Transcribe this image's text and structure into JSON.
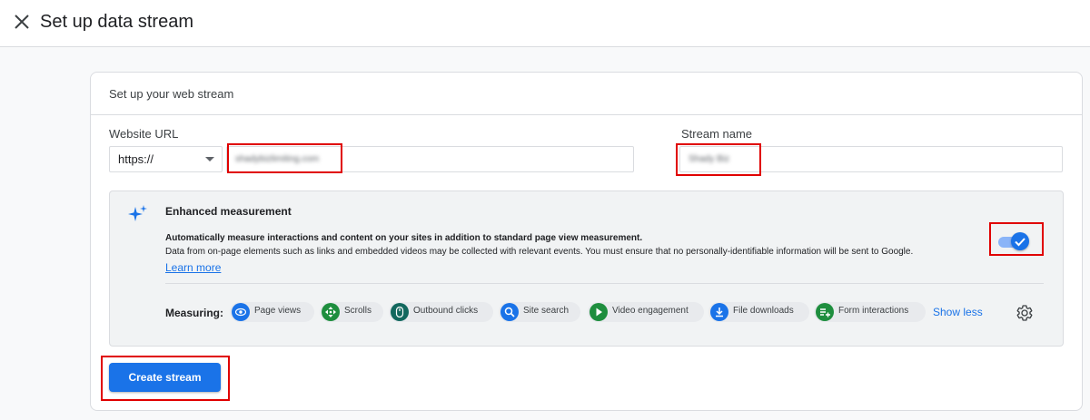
{
  "header": {
    "title": "Set up data stream",
    "close_icon": "close-icon"
  },
  "card": {
    "title": "Set up your web stream",
    "website_url": {
      "label": "Website URL",
      "protocol": "https://",
      "value": "shadybizlimiting.com"
    },
    "stream_name": {
      "label": "Stream name",
      "value": "Shady Biz"
    }
  },
  "enhanced": {
    "title": "Enhanced measurement",
    "description": "Automatically measure interactions and content on your sites in addition to standard page view measurement.",
    "description2": "Data from on-page elements such as links and embedded videos may be collected with relevant events. You must ensure that no personally-identifiable information will be sent to Google.",
    "learn_more": "Learn more",
    "toggle_on": true,
    "measuring_label": "Measuring:",
    "chips": [
      {
        "label": "Page views",
        "icon": "eye-icon",
        "color": "#1a73e8"
      },
      {
        "label": "Scrolls",
        "icon": "scroll-icon",
        "color": "#1e8e3e"
      },
      {
        "label": "Outbound clicks",
        "icon": "mouse-icon",
        "color": "#12685e"
      },
      {
        "label": "Site search",
        "icon": "search-icon",
        "color": "#1a73e8"
      },
      {
        "label": "Video engagement",
        "icon": "play-icon",
        "color": "#1e8e3e"
      },
      {
        "label": "File downloads",
        "icon": "download-icon",
        "color": "#1a73e8"
      },
      {
        "label": "Form interactions",
        "icon": "form-icon",
        "color": "#1e8e3e"
      }
    ],
    "show_less": "Show less",
    "settings_icon": "gear-icon"
  },
  "actions": {
    "create_stream": "Create stream"
  },
  "colors": {
    "primary": "#1a73e8",
    "highlight": "#e00000"
  }
}
